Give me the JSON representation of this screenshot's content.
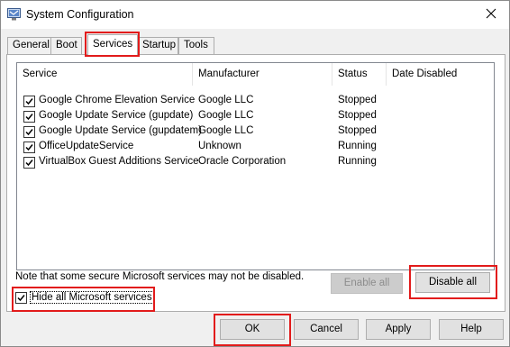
{
  "window": {
    "title": "System Configuration",
    "icons": {
      "app": "system-config-icon",
      "close": "close-icon",
      "check": "check-mark-icon"
    }
  },
  "tabs": [
    {
      "label": "General",
      "active": false
    },
    {
      "label": "Boot",
      "active": false
    },
    {
      "label": "Services",
      "active": true
    },
    {
      "label": "Startup",
      "active": false
    },
    {
      "label": "Tools",
      "active": false
    }
  ],
  "services": {
    "columns": [
      "Service",
      "Manufacturer",
      "Status",
      "Date Disabled"
    ],
    "rows": [
      {
        "checked": true,
        "name": "Google Chrome Elevation Service",
        "manufacturer": "Google LLC",
        "status": "Stopped",
        "date_disabled": ""
      },
      {
        "checked": true,
        "name": "Google Update Service (gupdate)",
        "manufacturer": "Google LLC",
        "status": "Stopped",
        "date_disabled": ""
      },
      {
        "checked": true,
        "name": "Google Update Service (gupdatem)",
        "manufacturer": "Google LLC",
        "status": "Stopped",
        "date_disabled": ""
      },
      {
        "checked": true,
        "name": "OfficeUpdateService",
        "manufacturer": "Unknown",
        "status": "Running",
        "date_disabled": ""
      },
      {
        "checked": true,
        "name": "VirtualBox Guest Additions Service",
        "manufacturer": "Oracle Corporation",
        "status": "Running",
        "date_disabled": ""
      }
    ],
    "note": "Note that some secure Microsoft services may not be disabled.",
    "enable_all": {
      "label": "Enable all",
      "enabled": false
    },
    "disable_all": {
      "label": "Disable all",
      "enabled": true
    },
    "hide_ms": {
      "label": "Hide all Microsoft services",
      "checked": true
    }
  },
  "footer": {
    "ok": "OK",
    "cancel": "Cancel",
    "apply": "Apply",
    "help": "Help"
  },
  "colors": {
    "highlight": "#e21b1b",
    "panel_bg": "#ffffff",
    "window_bg": "#f0f0f0",
    "button_bg": "#e1e1e1"
  }
}
